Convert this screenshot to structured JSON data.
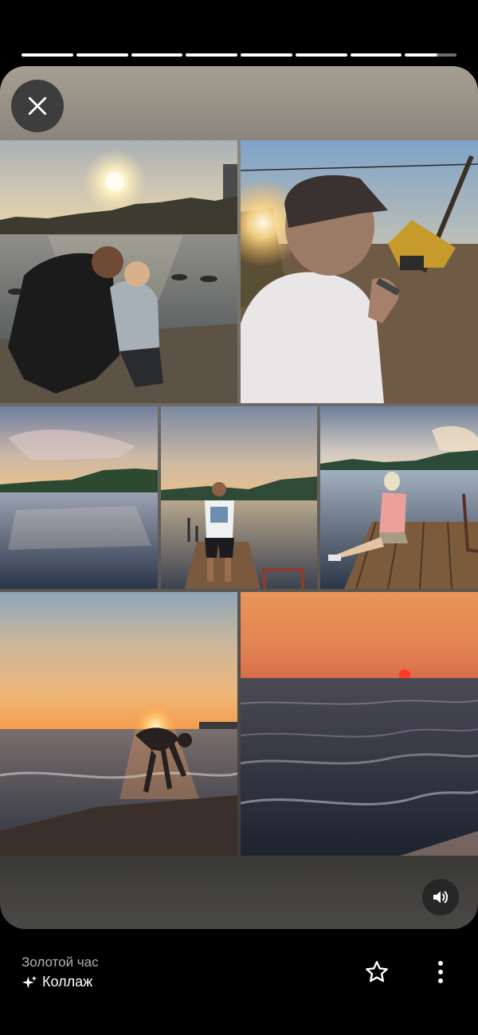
{
  "story": {
    "segments": 8,
    "current_segment_progress": 0.62
  },
  "card": {
    "close_icon": "close-icon",
    "sound_icon": "volume-on-icon"
  },
  "photos": [
    {
      "id": "father-child-lake"
    },
    {
      "id": "man-cap-sunset"
    },
    {
      "id": "lake-hills-sunset"
    },
    {
      "id": "man-on-pier"
    },
    {
      "id": "woman-on-pier"
    },
    {
      "id": "sunset-beach-man"
    },
    {
      "id": "sea-sunset"
    }
  ],
  "footer": {
    "title": "Золотой час",
    "subtitle": "Коллаж",
    "sparkle_icon": "sparkle-icon",
    "star_icon": "star-icon",
    "more_icon": "more-vert-icon"
  },
  "colors": {
    "background": "#000000",
    "title_gray": "#b3b3b3",
    "text_white": "#ffffff"
  }
}
